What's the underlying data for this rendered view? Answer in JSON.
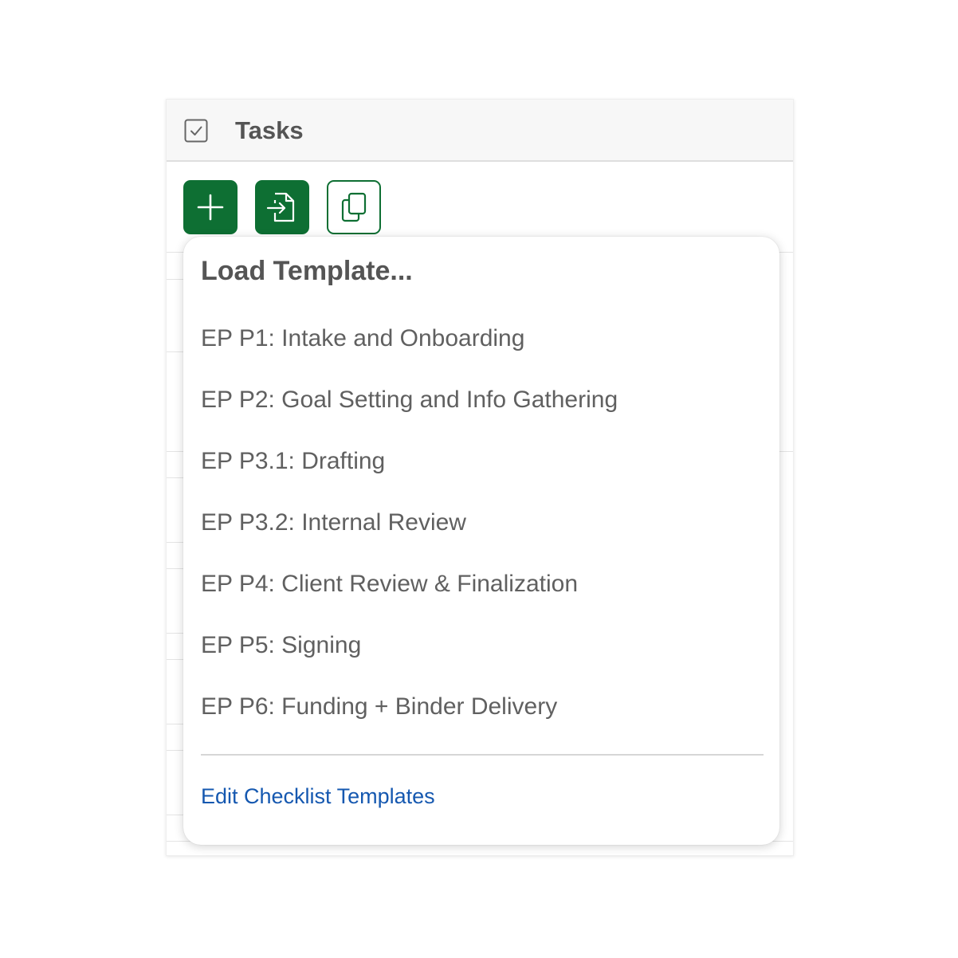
{
  "panel": {
    "title": "Tasks",
    "header_icon": "checkbox-icon"
  },
  "toolbar": {
    "add_icon": "plus-icon",
    "load_icon": "file-import-icon",
    "copy_icon": "copy-icon"
  },
  "dropdown": {
    "title": "Load Template...",
    "items": [
      {
        "label": "EP P1: Intake and Onboarding"
      },
      {
        "label": "EP P2: Goal Setting and Info Gathering"
      },
      {
        "label": "EP P3.1: Drafting"
      },
      {
        "label": "EP P3.2: Internal Review"
      },
      {
        "label": "EP P4: Client Review & Finalization"
      },
      {
        "label": "EP P5: Signing"
      },
      {
        "label": "EP P6: Funding + Binder Delivery"
      }
    ],
    "edit_link": "Edit Checklist Templates"
  },
  "colors": {
    "accent_green": "#0e6f33",
    "link_blue": "#1558b0",
    "text_gray": "#606060"
  }
}
